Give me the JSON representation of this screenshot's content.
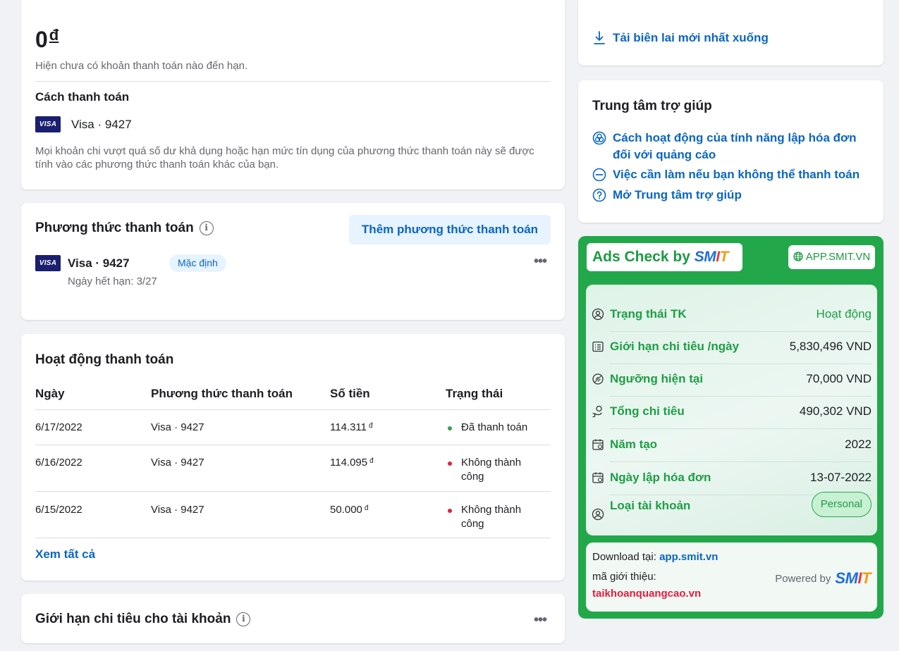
{
  "balance": {
    "amount": "0",
    "currency": "đ",
    "due_note": "Hiện chưa có khoản thanh toán nào đến hạn.",
    "method_title": "Cách thanh toán",
    "card_brand": "VISA",
    "card_label": "Visa · 9427",
    "note": "Mọi khoản chi vượt quá số dư khả dụng hoặc hạn mức tín dụng của phương thức thanh toán này sẽ được tính vào các phương thức thanh toán khác của bạn."
  },
  "methods": {
    "title": "Phương thức thanh toán",
    "add_button": "Thêm phương thức thanh toán",
    "card_brand": "VISA",
    "card_label": "Visa · 9427",
    "default_badge": "Mặc định",
    "expiry": "Ngày hết hạn: 3/27",
    "more": "•••"
  },
  "activity": {
    "title": "Hoạt động thanh toán",
    "columns": [
      "Ngày",
      "Phương thức thanh toán",
      "Số tiền",
      "Trạng thái"
    ],
    "rows": [
      {
        "date": "6/17/2022",
        "method": "Visa · 9427",
        "amount": "114.311",
        "currency": "đ",
        "status_l1": "Đã thanh toán",
        "status_l2": "",
        "status_color": "#31a24c"
      },
      {
        "date": "6/16/2022",
        "method": "Visa · 9427",
        "amount": "114.095",
        "currency": "đ",
        "status_l1": "Không thành",
        "status_l2": "công",
        "status_color": "#e41e3f"
      },
      {
        "date": "6/15/2022",
        "method": "Visa · 9427",
        "amount": "50.000",
        "currency": "đ",
        "status_l1": "Không thành",
        "status_l2": "công",
        "status_color": "#e41e3f"
      }
    ],
    "see_all": "Xem tất cả"
  },
  "limit": {
    "title": "Giới hạn chi tiêu cho tài khoản",
    "more": "•••"
  },
  "receipt": {
    "link": "Tải biên lai mới nhất xuống",
    "icon": "download-icon"
  },
  "help": {
    "title": "Trung tâm trợ giúp",
    "links": [
      {
        "l1": "Cách hoạt động của tính năng lập hóa đơn",
        "l2": "đối với quảng cáo",
        "icon": "billing-help-icon"
      },
      {
        "l1": "Việc cần làm nếu bạn không thể thanh toán",
        "l2": "",
        "icon": "minus-circle-icon"
      },
      {
        "l1": "Mở Trung tâm trợ giúp",
        "l2": "",
        "icon": "question-circle-icon"
      }
    ]
  },
  "smit": {
    "brand_prefix": "Ads Check by",
    "logo": {
      "s": "S",
      "m": "M",
      "i": "I",
      "t": "T"
    },
    "site_button": "APP.SMIT.VN",
    "rows": [
      {
        "label": "Trạng thái TK",
        "value": "Hoạt động",
        "icon": "user-circle-icon"
      },
      {
        "label": "Giới hạn chi tiêu /ngày",
        "value": "5,830,496 VND",
        "icon": "list-icon"
      },
      {
        "label": "Ngưỡng hiện tại",
        "value": "70,000 VND",
        "icon": "threshold-icon"
      },
      {
        "label": "Tổng chi tiêu",
        "value": "490,302 VND",
        "icon": "hand-money-icon"
      },
      {
        "label": "Năm tạo",
        "value": "2022",
        "icon": "calendar-icon"
      },
      {
        "label": "Ngày lập hóa đơn",
        "value": "13-07-2022",
        "icon": "calendar-clock-icon"
      },
      {
        "label": "Loại tài khoản",
        "value": "Personal",
        "icon": "user-circle-icon"
      }
    ],
    "footer": {
      "download_label": "Download tại:",
      "download_link": "app.smit.vn",
      "ref_label": "mã giới thiệu:",
      "ref_value": "taikhoanquangcao.vn",
      "powered": "Powered by"
    },
    "colors": {
      "green": "#22a84a",
      "label_green": "#1e9e45",
      "ref_red": "#e41e3f"
    }
  }
}
